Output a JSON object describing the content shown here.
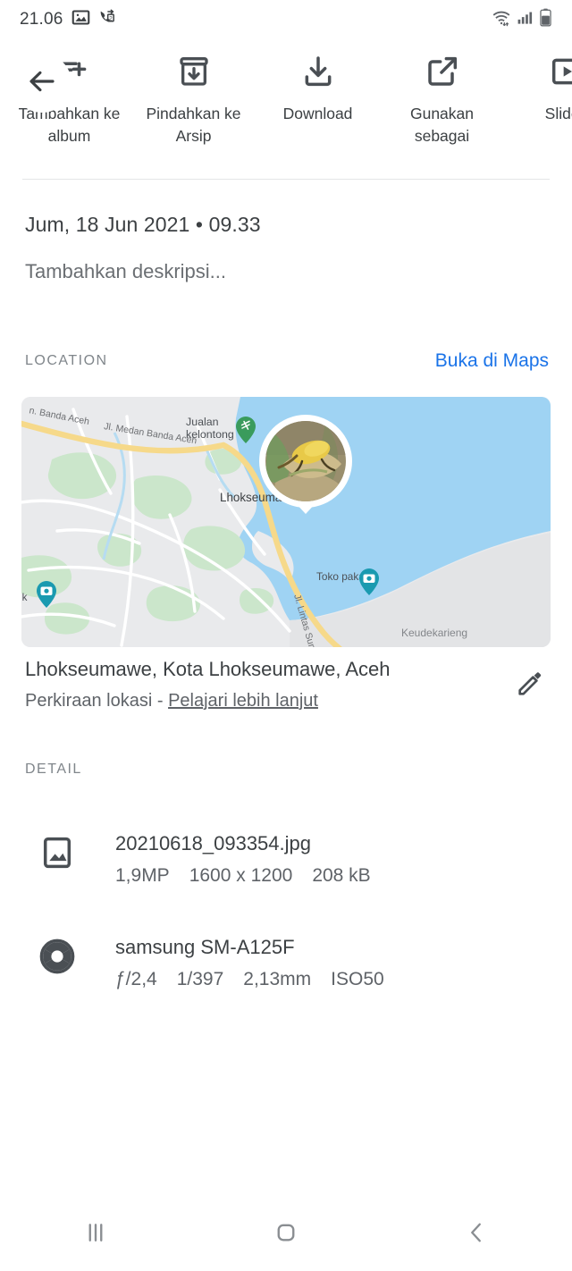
{
  "status_bar": {
    "clock": "21.06",
    "left_icons": [
      "image-icon",
      "call-forward-2-icon"
    ],
    "right_icons": [
      "wifi-icon",
      "signal-bars-icon",
      "battery-icon"
    ]
  },
  "actions": {
    "back_icon": "back-arrow-icon",
    "items": [
      {
        "label": "Tambahkan ke album",
        "icon": "add-to-album-icon"
      },
      {
        "label": "Pindahkan ke Arsip",
        "icon": "archive-icon"
      },
      {
        "label": "Download",
        "icon": "download-icon"
      },
      {
        "label": "Gunakan sebagai",
        "icon": "open-external-icon"
      },
      {
        "label": "Slides",
        "icon": "slideshow-icon"
      }
    ]
  },
  "info": {
    "date": "Jum, 18 Jun 2021  •  09.33",
    "description_placeholder": "Tambahkan deskripsi..."
  },
  "location": {
    "caption": "LOCATION",
    "maps_link": "Buka di Maps",
    "place_title": "Lhokseumawe, Kota Lhokseumawe, Aceh",
    "place_sub_prefix": "Perkiraan lokasi - ",
    "place_sub_link": "Pelajari lebih lanjut",
    "edit_icon": "pencil-icon",
    "map": {
      "labels": [
        "n. Banda Aceh",
        "Jl. Medan Banda Aceh",
        "Jualan kelontong",
        "Lhokseumawe",
        "Toko pakaian",
        "Keudekarieng",
        "Jl. Lintas Sum",
        "ik"
      ],
      "colors": {
        "land": "#e9eaec",
        "water": "#9fd3f3",
        "park": "#cbe6cb",
        "road": "#ffffff",
        "highway": "#f6d98a",
        "pin": "#1a9ab0",
        "pin_green": "#3a9b5c"
      },
      "photo_marker": "photo-location-marker"
    }
  },
  "detail": {
    "caption": "DETAIL",
    "file": {
      "icon": "image-file-icon",
      "name": "20210618_093354.jpg",
      "meta": [
        "1,9MP",
        "1600 x 1200",
        "208 kB"
      ]
    },
    "camera": {
      "icon": "aperture-icon",
      "name": "samsung SM-A125F",
      "meta": [
        "ƒ/2,4",
        "1/397",
        "2,13mm",
        "ISO50"
      ]
    }
  },
  "nav_bar": {
    "recents_icon": "recents-icon",
    "home_icon": "home-icon",
    "back_icon": "nav-back-icon"
  }
}
